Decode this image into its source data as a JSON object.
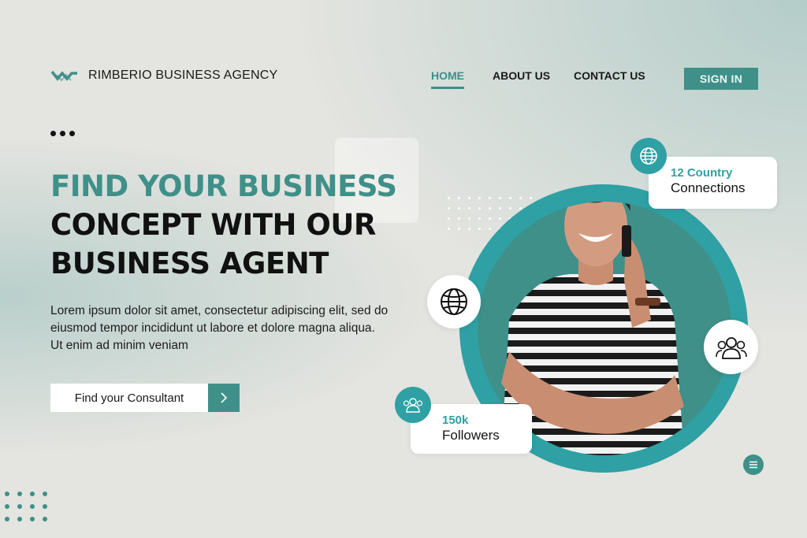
{
  "brand": {
    "name": "RIMBERIO BUSINESS AGENCY",
    "logo_icon": "wave-w-logo"
  },
  "nav": {
    "items": [
      {
        "label": "HOME",
        "active": true
      },
      {
        "label": "ABOUT US",
        "active": false
      },
      {
        "label": "CONTACT US",
        "active": false
      }
    ]
  },
  "header": {
    "signin_label": "SIGN IN"
  },
  "hero": {
    "title_line1": "FIND YOUR BUSINESS",
    "title_line2": "CONCEPT WITH OUR",
    "title_line3": "BUSINESS AGENT",
    "lead": "Lorem ipsum dolor sit amet, consectetur adipiscing elit, sed do eiusmod tempor incididunt ut labore et dolore magna aliqua. Ut enim ad minim veniam",
    "cta_label": "Find your Consultant",
    "cta_icon": "chevron-right-icon"
  },
  "stats": {
    "country": {
      "value": "12 Country",
      "label": "Connections",
      "icon": "globe-icon"
    },
    "followers": {
      "value": "150k",
      "label": "Followers",
      "icon": "people-icon"
    }
  },
  "colors": {
    "accent": "#3f9089",
    "accent_bright": "#2fa0a4",
    "background": "#e4e4e0",
    "text": "#111111"
  }
}
